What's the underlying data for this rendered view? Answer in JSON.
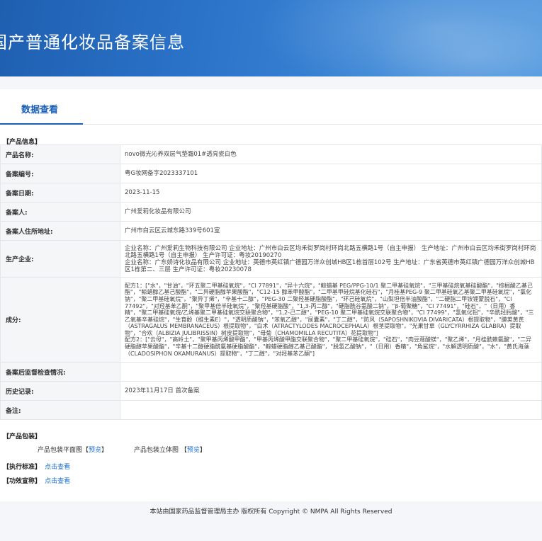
{
  "header": {
    "title": "国产普通化妆品备案信息"
  },
  "tab": {
    "label": "数据查看"
  },
  "sections": {
    "product_info": "【产品信息】",
    "product_packaging": "【产品包装】",
    "standard": "【执行标准】",
    "efficacy": "【功效宣称】"
  },
  "info_rows": [
    {
      "key": "产品名称:",
      "value": "novo微光沁养双层气垫霜01#透亮瓷白色"
    },
    {
      "key": "备案编号:",
      "value": "粤G妆网备字2023337101"
    },
    {
      "key": "备案日期:",
      "value": "2023-11-15"
    },
    {
      "key": "备案人:",
      "value": "广州爱莉化妆品有限公司"
    },
    {
      "key": "备案人住所地址:",
      "value": "广州市白云区云城东路339号601室"
    },
    {
      "key": "生产企业:",
      "value": "企业名称：广州爱莉生物科技有限公司 企业地址：广州市白云区均禾街罗岗村环岗北路五横路1号（自主申报） 生产地址：广州市白云区均禾街罗岗村环岗北路五横路1号（自主申报） 生产许可证：粤妆20190270\n企业名称：广东娇诗化妆品有限公司 企业地址：英德市英红镇广德园万洋众创城HB区1栋首层102号 生产地址：广东省英德市英红镇广德园万洋众创城HB区1栋第二、三层 生产许可证：粤妆20230078"
    },
    {
      "key": "成分:",
      "value": "配方1：[\"水\"，\"甘油\"，\"环五聚二甲基硅氧烷\"，\"CI 77891\"，\"异十六烷\"，\"鲸蜡基 PEG/PPG-10/1 聚二甲基硅氧烷\"，\"三甲基硅烷氧基硅酸酯\"，\"棕榈酸乙基己酯\"，\"鲸蜡醇乙基己酸酯\"，\"二异硬脂醇苹果酸酯\"，\"C12-15 醇苯甲酸酯\"，\"二甲基甲硅烷基化硅石\"，\"月桂基PEG-9 聚二甲基硅氧乙基聚二甲基硅氧烷\"，\"氯化钠\"，\"聚二甲基硅氧烷\"，\"聚异丁烯\"，\"辛基十二醇\"，\"PEG-30 二聚羟基硬脂酸酯\"，\"环己硅氧烷\"，\"山梨坦倍半油酸酯\"，\"二硬脂二甲铵锂蒙脱石\"，\"CI 77492\"，\"对羟基苯乙酮\"，\"聚甲基倍半硅氧烷\"，\"聚羟基硬脂酸\"，\"1,3-丙二醇\"，\"硬脂酰谷氨酸二钠\"，\"β-葡聚糖\"，\"CI 77491\"，\"硅石\"，\"（日用）香精\"，\"聚二甲基硅氧烷/乙烯基聚二甲基硅氧烷交联聚合物\"，\"1,2-己二醇\"，\"PEG-10 聚二甲基硅氧烷交联聚合物\"，\"CI 77499\"，\"氢氧化铝\"，\"辛酰羟肟酸\"，\"三乙氧基辛基硅烷\"，\"生育酚（维生素E）\"，\"透明质酸钠\"，\"苯氧乙醇\"，\"尿囊素\"，\"丁二醇\"，\"防风（SAPOSHNIKOVIA DIVARICATA）根提取物\"，\"膜荚黄芪（ASTRAGALUS MEMBRANACEUS）根提取物\"，\"白术（ATRACTYLODES MACROCEPHALA）根茎提取物\"，\"光果甘草（GLYCYRRHIZA GLABRA）提取物\"，\"合欢（ALBIZIA JULIBRISSIN）树皮提取物\"，\"母菊（CHAMOMILLA RECUTITA）花提取物\"]\n配方2：[\"云母\"，\"高岭土\"，\"聚甲基丙烯酸甲酯\"，\"甲基丙烯酸甲酯交联聚合物\"，\"聚二甲基硅氧烷\"，\"硅石\"，\"肉豆蔻酸镁\"，\"聚乙烯\"，\"月桂酰赖氨酸\"，\"二异硬脂醇苹果酸酯\"，\"辛基十二醇硬脂酰氨基硬脂酸酯\"，\"鲸蜡硬脂醇乙基己酸酯\"，\"脱氢乙酸钠\"，\"（日用）香精\"，\"角鲨烷\"，\"水解透明质酸\"，\"水\"，\"黄氏海藻（CLADOSIPHON OKAMURANUS）提取物\"，\"丁二醇\"，\"对羟基苯乙酮\"]"
    },
    {
      "key": "备案后监督检查情况:",
      "value": ""
    },
    {
      "key": "历史记录:",
      "value": "2023年11月17日 首次备案"
    },
    {
      "key": "备注:",
      "value": ""
    }
  ],
  "packaging": {
    "flat_label": "产品包装平面图【",
    "flat_link": "预览",
    "flat_close": "】",
    "stereo_label": "产品包装立体图 【",
    "stereo_link": "预览",
    "stereo_close": "】"
  },
  "standard_link": "点击查看",
  "efficacy_link": "点击查看",
  "footer": {
    "text": "本站由国家药品监督管理局主办 版权所有 Copyright © NMPA All Rights Reserved"
  }
}
